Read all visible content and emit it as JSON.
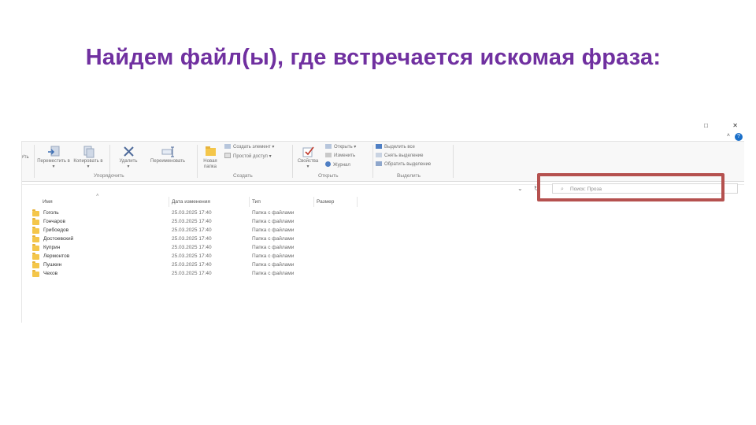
{
  "slide_title": "Найдем файл(ы), где встречается искомая фраза:",
  "window_controls": {
    "restore": "□",
    "close": "✕",
    "help": "?",
    "collapse": "˄"
  },
  "ribbon": {
    "left_stub": "Уть",
    "organize": {
      "move_label": "Переместить в",
      "copy_label": "Копировать в",
      "delete_label": "Удалить",
      "rename_label": "Переименовать",
      "group_label": "Упорядочить"
    },
    "create": {
      "new_folder_label": "Новая папка",
      "new_item_label": "Создать элемент",
      "easy_access_label": "Простой доступ",
      "group_label": "Создать"
    },
    "open": {
      "properties_label": "Свойства",
      "open_label": "Открыть",
      "edit_label": "Изменить",
      "history_label": "Журнал",
      "group_label": "Открыть"
    },
    "select": {
      "select_all_label": "Выделить все",
      "select_none_label": "Снять выделение",
      "invert_label": "Обратить выделение",
      "group_label": "Выделить"
    }
  },
  "search": {
    "placeholder": "Поиск: Проза"
  },
  "columns": [
    "Имя",
    "Дата изменения",
    "Тип",
    "Размер"
  ],
  "files": [
    {
      "name": "Гоголь",
      "date": "25.03.2025 17:40",
      "type": "Папка с файлами"
    },
    {
      "name": "Гончаров",
      "date": "25.03.2025 17:40",
      "type": "Папка с файлами"
    },
    {
      "name": "Грибоедов",
      "date": "25.03.2025 17:40",
      "type": "Папка с файлами"
    },
    {
      "name": "Достоевский",
      "date": "25.03.2025 17:40",
      "type": "Папка с файлами"
    },
    {
      "name": "Куприн",
      "date": "25.03.2025 17:40",
      "type": "Папка с файлами"
    },
    {
      "name": "Лермонтов",
      "date": "25.03.2025 17:40",
      "type": "Папка с файлами"
    },
    {
      "name": "Пушкин",
      "date": "25.03.2025 17:40",
      "type": "Папка с файлами"
    },
    {
      "name": "Чехов",
      "date": "25.03.2025 17:40",
      "type": "Папка с файлами"
    }
  ],
  "colors": {
    "title": "#7030a0",
    "highlight": "#b5514f",
    "folder": "#f4c64a",
    "accent": "#1a6fc9"
  }
}
